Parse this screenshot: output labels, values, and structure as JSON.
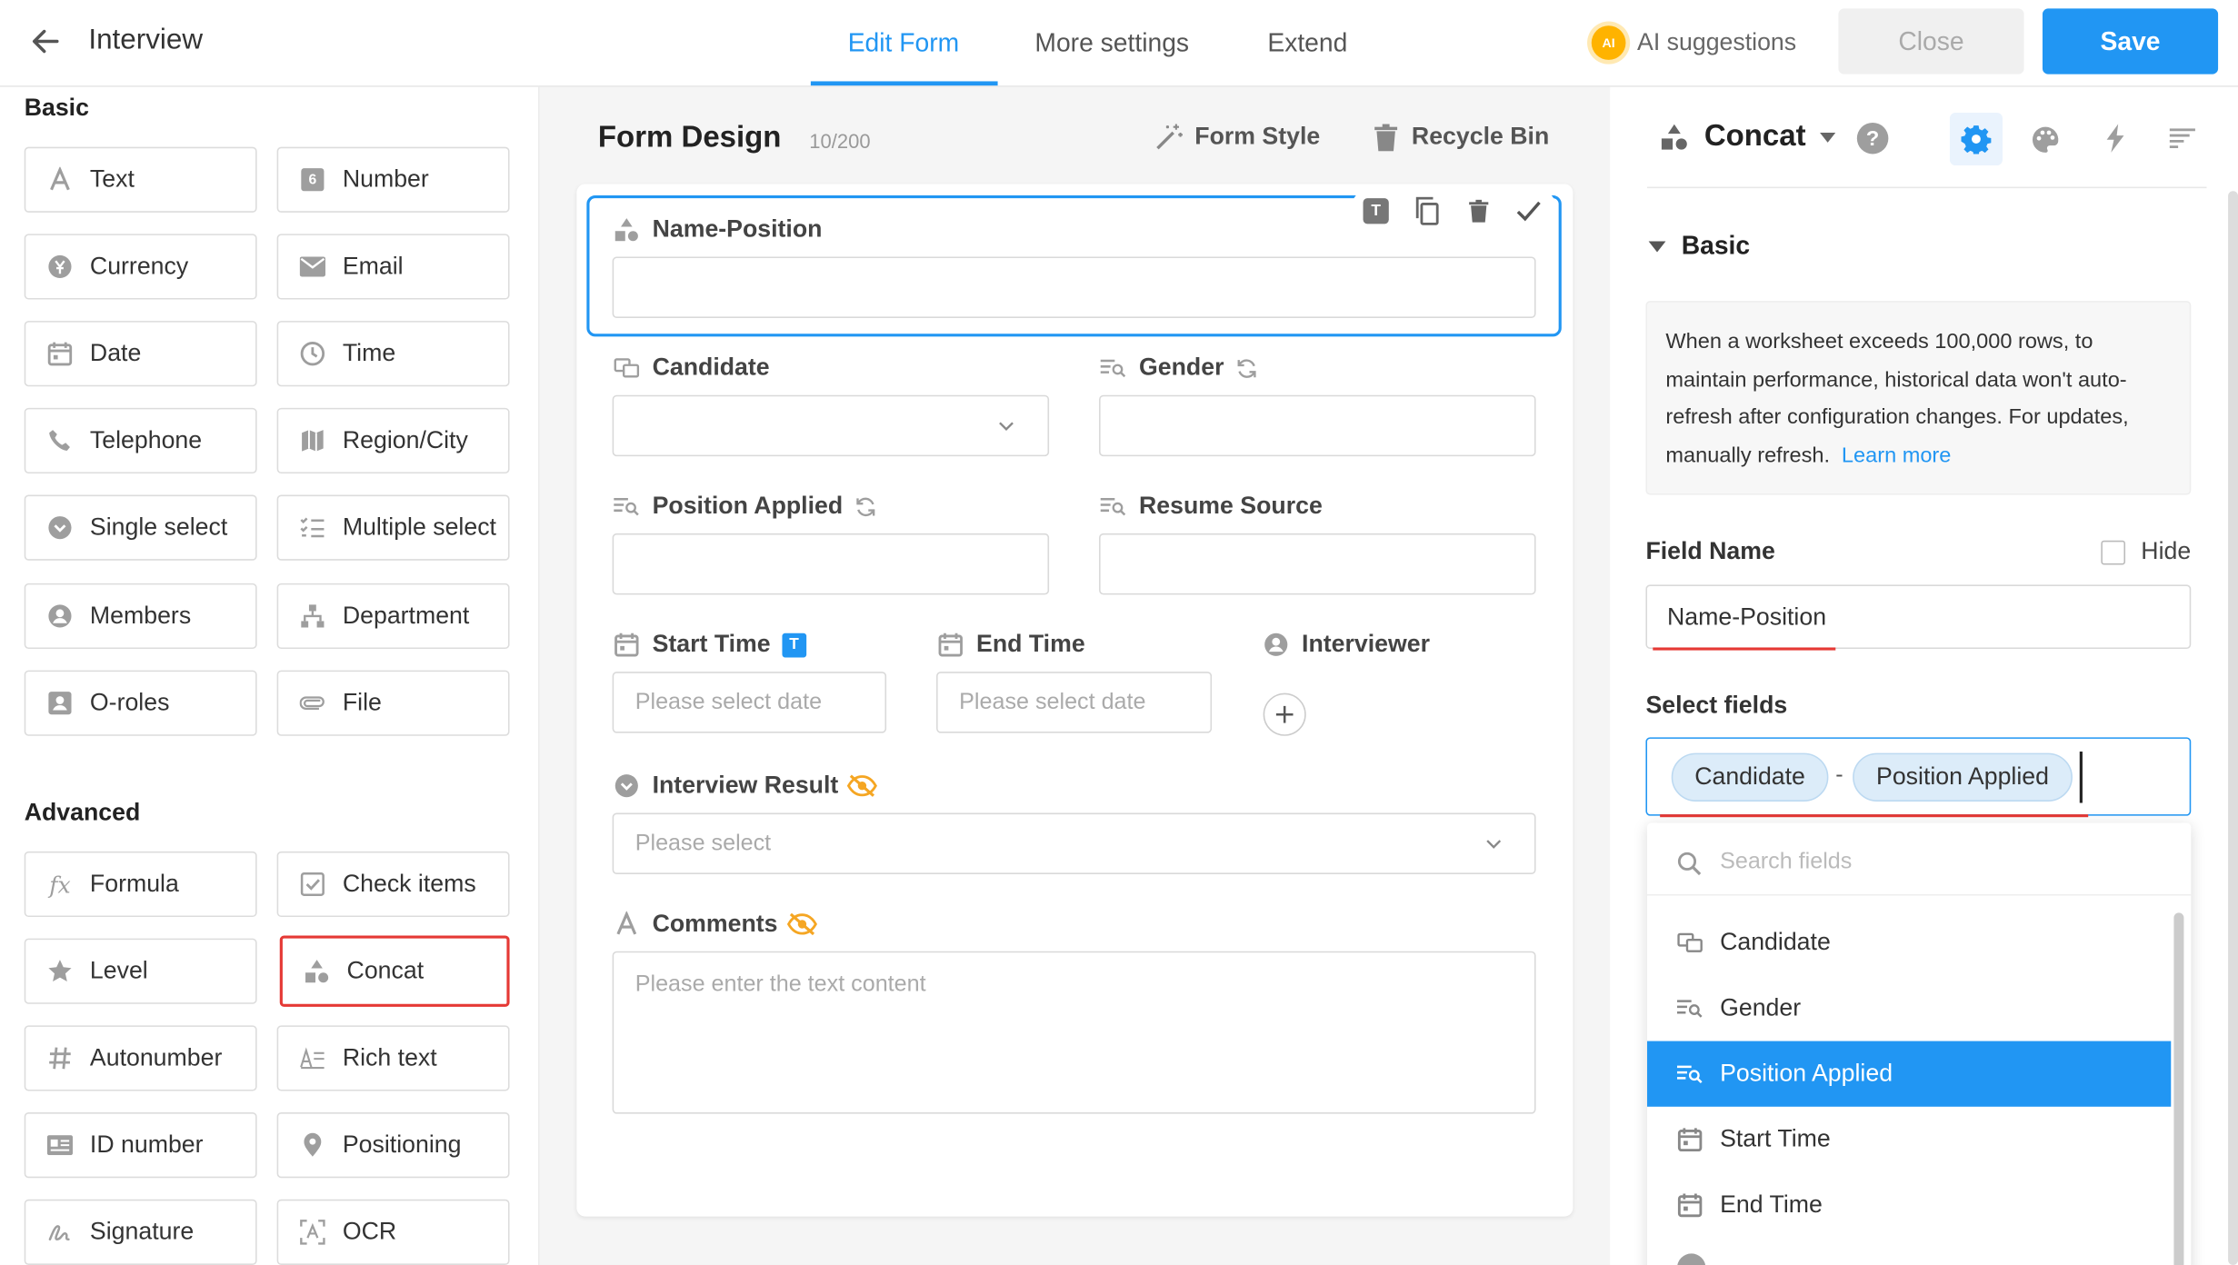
{
  "header": {
    "back_icon": "arrow-left-icon",
    "title": "Interview",
    "tabs": [
      "Edit Form",
      "More settings",
      "Extend"
    ],
    "ai_label": "AI suggestions",
    "ai_badge": "AI",
    "close_label": "Close",
    "save_label": "Save",
    "accent": "#2196f3"
  },
  "left": {
    "basic_title": "Basic",
    "advanced_title": "Advanced",
    "basic_items": [
      "Text",
      "Number",
      "Currency",
      "Email",
      "Date",
      "Time",
      "Telephone",
      "Region/City",
      "Single select",
      "Multiple select",
      "Members",
      "Department",
      "O-roles",
      "File"
    ],
    "advanced_items": [
      "Formula",
      "Check items",
      "Level",
      "Concat",
      "Autonumber",
      "Rich text",
      "ID number",
      "Positioning",
      "Signature",
      "OCR"
    ],
    "icons": {
      "number": "6",
      "formula": "fx"
    }
  },
  "center": {
    "title": "Form Design",
    "count": "10/200",
    "form_style": "Form Style",
    "recycle_bin": "Recycle Bin",
    "fields": {
      "name_position": "Name-Position",
      "candidate": "Candidate",
      "gender": "Gender",
      "position_applied": "Position Applied",
      "resume_source": "Resume Source",
      "start_time": "Start Time",
      "start_time_badge": "T",
      "end_time": "End Time",
      "interviewer": "Interviewer",
      "interview_result": "Interview Result",
      "comments": "Comments"
    },
    "placeholders": {
      "date": "Please select date",
      "select": "Please select",
      "text": "Please enter the text content"
    },
    "toolbar_badge": "T"
  },
  "right": {
    "control_name": "Concat",
    "basic_label": "Basic",
    "notice": "When a worksheet exceeds 100,000 rows, to maintain performance, historical data won't auto-refresh after configuration changes. For updates, manually refresh.",
    "learn_more": "Learn more",
    "field_name_label": "Field Name",
    "hide_label": "Hide",
    "field_name_value": "Name-Position",
    "select_fields_label": "Select fields",
    "chips": [
      "Candidate",
      "Position Applied"
    ],
    "chip_separator": "-",
    "search_placeholder": "Search fields",
    "dropdown_items": [
      "Candidate",
      "Gender",
      "Position Applied",
      "Start Time",
      "End Time"
    ],
    "highlighted_item": "Position Applied"
  }
}
